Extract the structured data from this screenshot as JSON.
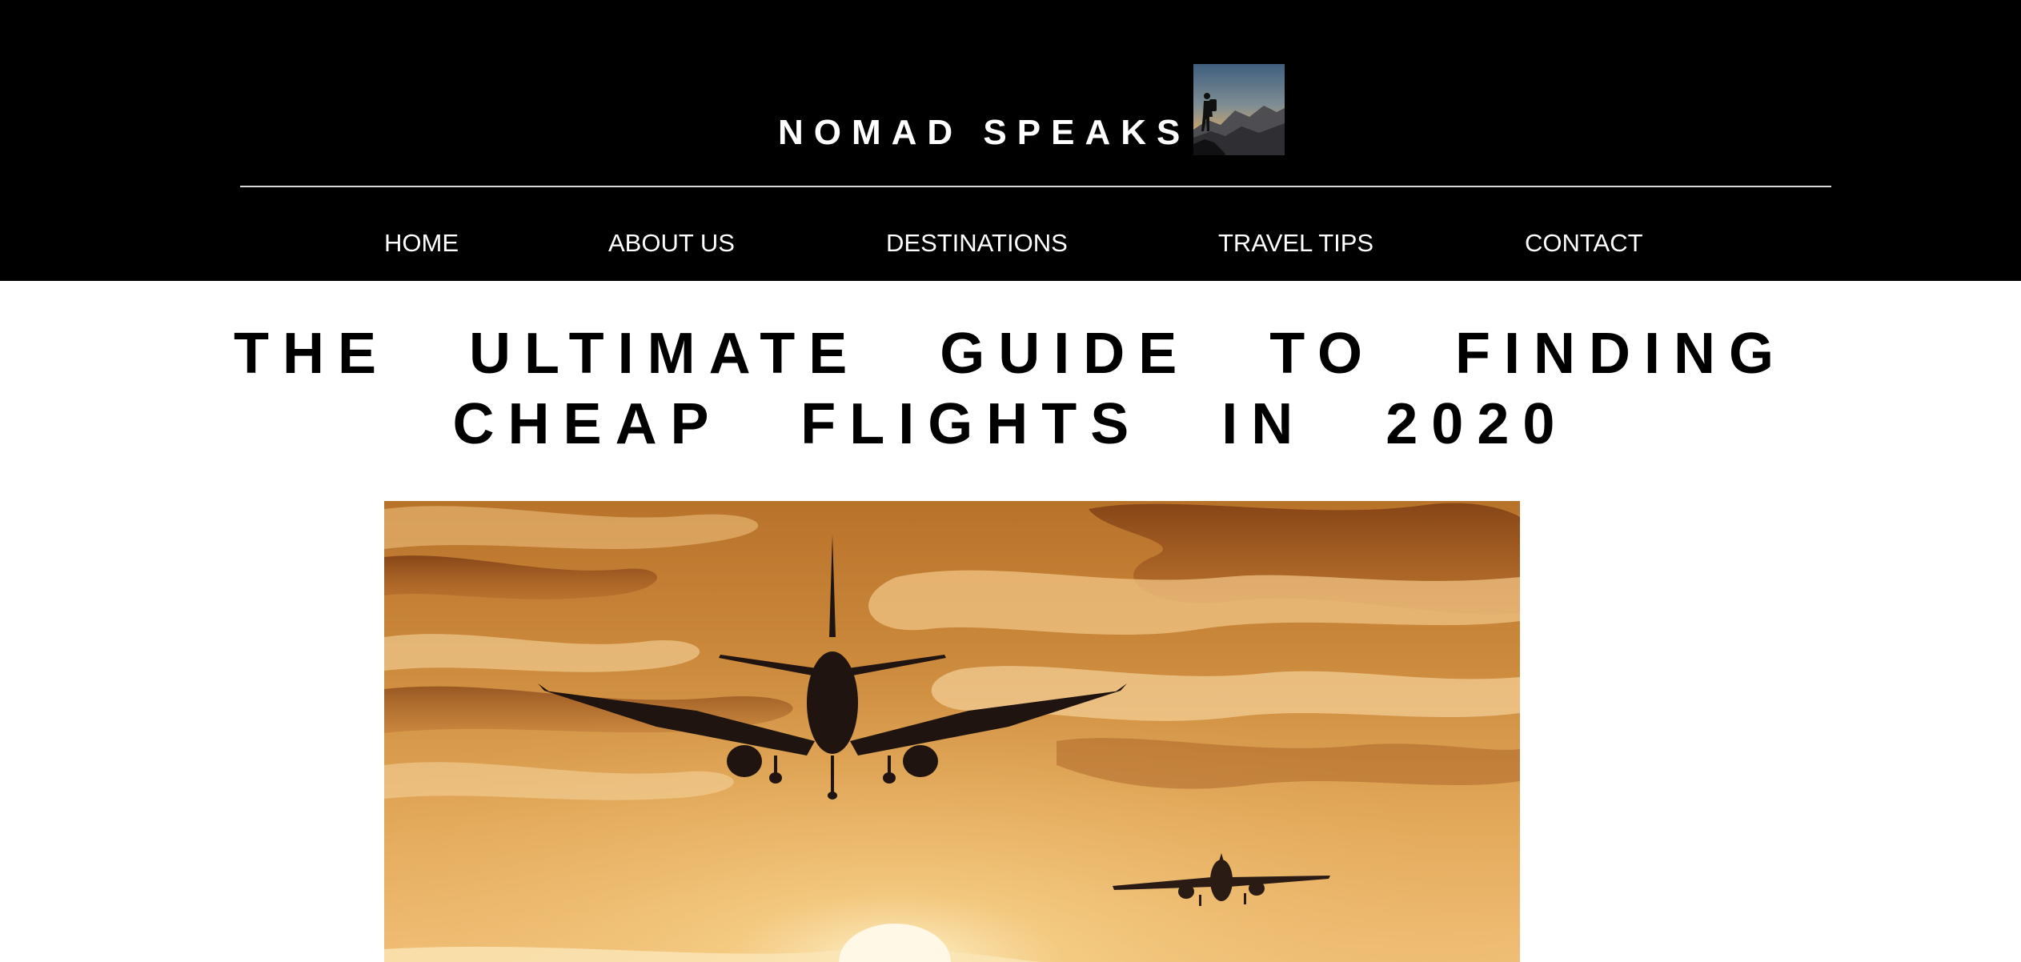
{
  "site": {
    "brand_name": "NOMAD SPEAKS",
    "logo_icon": "hiker-on-mountain-logo",
    "colors": {
      "header_background": "#000000",
      "header_text": "#ffffff",
      "page_background": "#ffffff",
      "title_text": "#000000"
    }
  },
  "nav": {
    "items": [
      {
        "label": "HOME"
      },
      {
        "label": "ABOUT US"
      },
      {
        "label": "DESTINATIONS"
      },
      {
        "label": "TRAVEL TIPS"
      },
      {
        "label": "CONTACT"
      }
    ]
  },
  "article": {
    "title": "THE ULTIMATE GUIDE TO FINDING CHEAP FLIGHTS IN 2020",
    "hero_image": "airplanes-flying-at-sunset-photo"
  }
}
